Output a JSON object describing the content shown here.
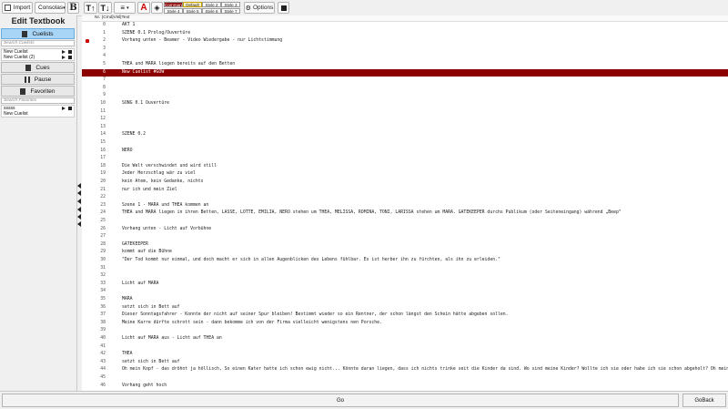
{
  "toolbar": {
    "import_label": "Import",
    "font_select": "Consolas",
    "bold_label": "B",
    "options_label": "Options",
    "styles": [
      "Command",
      "Default",
      "Style 2",
      "Style 3",
      "Style 4",
      "Style 5",
      "Style 6",
      "Style 7"
    ]
  },
  "sidebar": {
    "title": "Edit Textbook",
    "cuelists_label": "Cuelists",
    "search_cuelists_placeholder": "Search Cuelists",
    "cuelists": [
      "New Cuelist",
      "New Cuelist (2)"
    ],
    "cues_label": "Cues",
    "pause_label": "Pause",
    "favoriten_label": "Favoriten",
    "search_favorites_placeholder": "Search Favorites",
    "favorites": [
      "sssss",
      "New Cuelist"
    ]
  },
  "editor": {
    "header": {
      "nr": "Nr.",
      "cols": "|Cmd|Visl|Text"
    },
    "rows": [
      {
        "n": "0",
        "t": "AKT 1"
      },
      {
        "n": "1",
        "t": "SZENE 0.1  Prolog/Ouvertüre"
      },
      {
        "n": "2",
        "t": "Vorhang unten - Beamer - Video Wiedergabe - nur Lichtstimmung"
      },
      {
        "n": "3",
        "t": ""
      },
      {
        "n": "4",
        "t": ""
      },
      {
        "n": "5",
        "t": "THEA und MARA liegen bereits auf den Betten"
      },
      {
        "n": "6",
        "t": "New Cuelist #GOW"
      },
      {
        "n": "7",
        "t": ""
      },
      {
        "n": "8",
        "t": ""
      },
      {
        "n": "9",
        "t": ""
      },
      {
        "n": "10",
        "t": "SONG 0.1   Ouvertüre"
      },
      {
        "n": "11",
        "t": ""
      },
      {
        "n": "12",
        "t": ""
      },
      {
        "n": "13",
        "t": ""
      },
      {
        "n": "14",
        "t": "SZENE 0.2"
      },
      {
        "n": "15",
        "t": ""
      },
      {
        "n": "16",
        "t": "NERO"
      },
      {
        "n": "17",
        "t": ""
      },
      {
        "n": "18",
        "t": "Die Welt verschwindet und wird still"
      },
      {
        "n": "19",
        "t": "Jeder Herzschlag wär zu viel"
      },
      {
        "n": "20",
        "t": "kein Atem, kein Gedanke, nichts"
      },
      {
        "n": "21",
        "t": "nur ich und mein Ziel"
      },
      {
        "n": "22",
        "t": ""
      },
      {
        "n": "23",
        "t": "Szene 1 - MARA und THEA kommen an"
      },
      {
        "n": "24",
        "t": "THEA und MARA liegen in ihren Betten, LASSE, LOTTE, EMILIA, NERO stehen um THEA, MELISSA, ROMINA, TONI, LARISSA stehen um MARA. GATEKEEPER durchs Publikum (oder Seiteneingang) während „Beep\""
      },
      {
        "n": "25",
        "t": ""
      },
      {
        "n": "26",
        "t": "Vorhang unten - Licht auf Vorbühne"
      },
      {
        "n": "27",
        "t": ""
      },
      {
        "n": "28",
        "t": "GATEKEEPER"
      },
      {
        "n": "29",
        "t": "kommt auf die Bühne"
      },
      {
        "n": "30",
        "t": "\"Der Tod kommt nur einmal, und doch macht er sich in allen Augenblicken des Lebens fühlbar. Es ist herber ihn zu fürchten, als ihn zu erleiden.\""
      },
      {
        "n": "31",
        "t": ""
      },
      {
        "n": "32",
        "t": ""
      },
      {
        "n": "33",
        "t": "Licht auf MARA"
      },
      {
        "n": "34",
        "t": ""
      },
      {
        "n": "35",
        "t": "MARA"
      },
      {
        "n": "36",
        "t": "setzt sich in Bett auf"
      },
      {
        "n": "37",
        "t": "Dieser Sonntagsfahrer - Konnte der nicht auf seiner Spur bleiben! Bestimmt wieder so ein Rentner, der schon längst den Schein hätte abgeben sollen."
      },
      {
        "n": "38",
        "t": "Meine Karre dürfte schrott sein - dann bekomme ich von der Firma vielleicht wenigstens nen Porsche."
      },
      {
        "n": "39",
        "t": ""
      },
      {
        "n": "40",
        "t": "Licht auf MARA aus - Licht auf THEA an"
      },
      {
        "n": "41",
        "t": ""
      },
      {
        "n": "42",
        "t": "THEA"
      },
      {
        "n": "43",
        "t": "setzt sich in Bett auf"
      },
      {
        "n": "44",
        "t": "Oh mein Kopf - das dröhnt ja höllisch, So einen Kater hatte ich schon ewig nicht... Könnte daran liegen, dass ich nichts trinke seit die Kinder da sind.  Wo sind meine Kinder? Wollte ich sie oder habe ich sie schon abgeholt? Oh mein Kopf."
      },
      {
        "n": "45",
        "t": ""
      },
      {
        "n": "46",
        "t": "Vorhang geht hoch"
      }
    ]
  },
  "bottom": {
    "go_label": "Go",
    "goback_label": "GoBack"
  }
}
